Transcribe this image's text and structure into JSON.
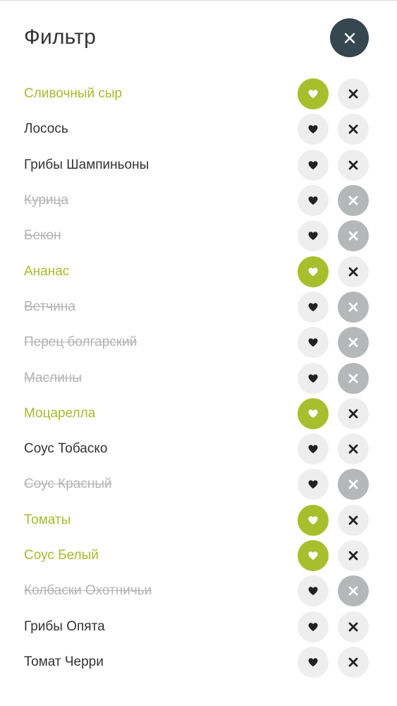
{
  "header": {
    "title": "Фильтр",
    "close_icon": "close-icon"
  },
  "colors": {
    "liked_accent": "#a8bf2d",
    "liked_text": "#a4bd2e",
    "excluded_button": "#b5b8b9",
    "excluded_text": "#b3b3b3",
    "neutral_button": "#eeeeee",
    "close_button": "#37474f",
    "text": "#333333"
  },
  "icons": {
    "like": "heart-icon",
    "exclude": "cross-icon"
  },
  "ingredients": [
    {
      "name": "Сливочный сыр",
      "state": "liked"
    },
    {
      "name": "Лосось",
      "state": "neutral"
    },
    {
      "name": "Грибы Шампиньоны",
      "state": "neutral"
    },
    {
      "name": "Курица",
      "state": "excluded"
    },
    {
      "name": "Бекон",
      "state": "excluded"
    },
    {
      "name": "Ананас",
      "state": "liked"
    },
    {
      "name": "Ветчина",
      "state": "excluded"
    },
    {
      "name": "Перец болгарский",
      "state": "excluded"
    },
    {
      "name": "Маслины",
      "state": "excluded"
    },
    {
      "name": "Моцарелла",
      "state": "liked"
    },
    {
      "name": "Соус Тобаско",
      "state": "neutral"
    },
    {
      "name": "Соус Красный",
      "state": "excluded"
    },
    {
      "name": "Томаты",
      "state": "liked"
    },
    {
      "name": "Соус Белый",
      "state": "liked"
    },
    {
      "name": "Колбаски Охотничьи",
      "state": "excluded"
    },
    {
      "name": "Грибы Опята",
      "state": "neutral"
    },
    {
      "name": "Томат Черри",
      "state": "neutral"
    }
  ]
}
